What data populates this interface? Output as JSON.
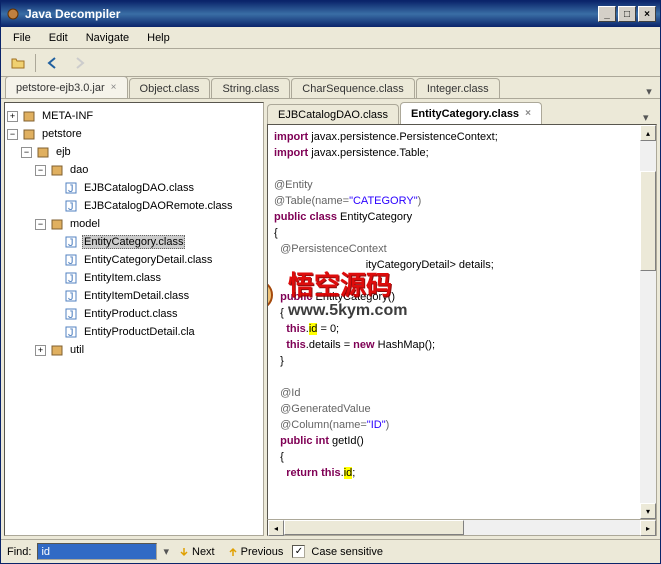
{
  "window": {
    "title": "Java Decompiler"
  },
  "menu": {
    "file": "File",
    "edit": "Edit",
    "navigate": "Navigate",
    "help": "Help"
  },
  "filetabs": {
    "main": "petstore-ejb3.0.jar",
    "t1": "Object.class",
    "t2": "String.class",
    "t3": "CharSequence.class",
    "t4": "Integer.class"
  },
  "tree": {
    "meta": "META-INF",
    "petstore": "petstore",
    "ejb": "ejb",
    "dao": "dao",
    "dao1": "EJBCatalogDAO.class",
    "dao2": "EJBCatalogDAORemote.class",
    "model": "model",
    "m1": "EntityCategory.class",
    "m2": "EntityCategoryDetail.class",
    "m3": "EntityItem.class",
    "m4": "EntityItemDetail.class",
    "m5": "EntityProduct.class",
    "m6": "EntityProductDetail.cla",
    "util": "util"
  },
  "codetabs": {
    "t1": "EJBCatalogDAO.class",
    "t2": "EntityCategory.class"
  },
  "code": {
    "l1a": "import",
    "l1b": " javax.persistence.PersistenceContext;",
    "l2a": "import",
    "l2b": " javax.persistence.Table;",
    "l4": "@Entity",
    "l5a": "@Table(name=",
    "l5b": "\"CATEGORY\"",
    "l5c": ")",
    "l6a": "public",
    "l6b": " class",
    "l6c": " EntityCategory",
    "l7": "{",
    "l8": "  @PersistenceContext",
    "l9a": "                              ",
    "l9b": "ityCategoryDetail> details;",
    "l10": "",
    "l11a": "  public",
    "l11b": " EntityCategory()",
    "l12": "  {",
    "l13a": "    this",
    "l13b": ".",
    "l13c": "id",
    "l13d": " = 0;",
    "l14a": "    this",
    "l14b": ".details = ",
    "l14c": "new",
    "l14d": " HashMap();",
    "l15": "  }",
    "l17": "  @Id",
    "l18": "  @GeneratedValue",
    "l19a": "  @Column(name=",
    "l19b": "\"ID\"",
    "l19c": ")",
    "l20a": "  public",
    "l20b": " int",
    "l20c": " getId()",
    "l21": "  {",
    "l22a": "    return",
    "l22b": " this",
    "l22c": ".",
    "l22d": "id",
    "l22e": ";"
  },
  "watermark": {
    "chars": "悟空源码",
    "url": "www.5kym.com"
  },
  "find": {
    "label": "Find:",
    "value": "id",
    "next": "Next",
    "prev": "Previous",
    "case": "Case sensitive"
  }
}
